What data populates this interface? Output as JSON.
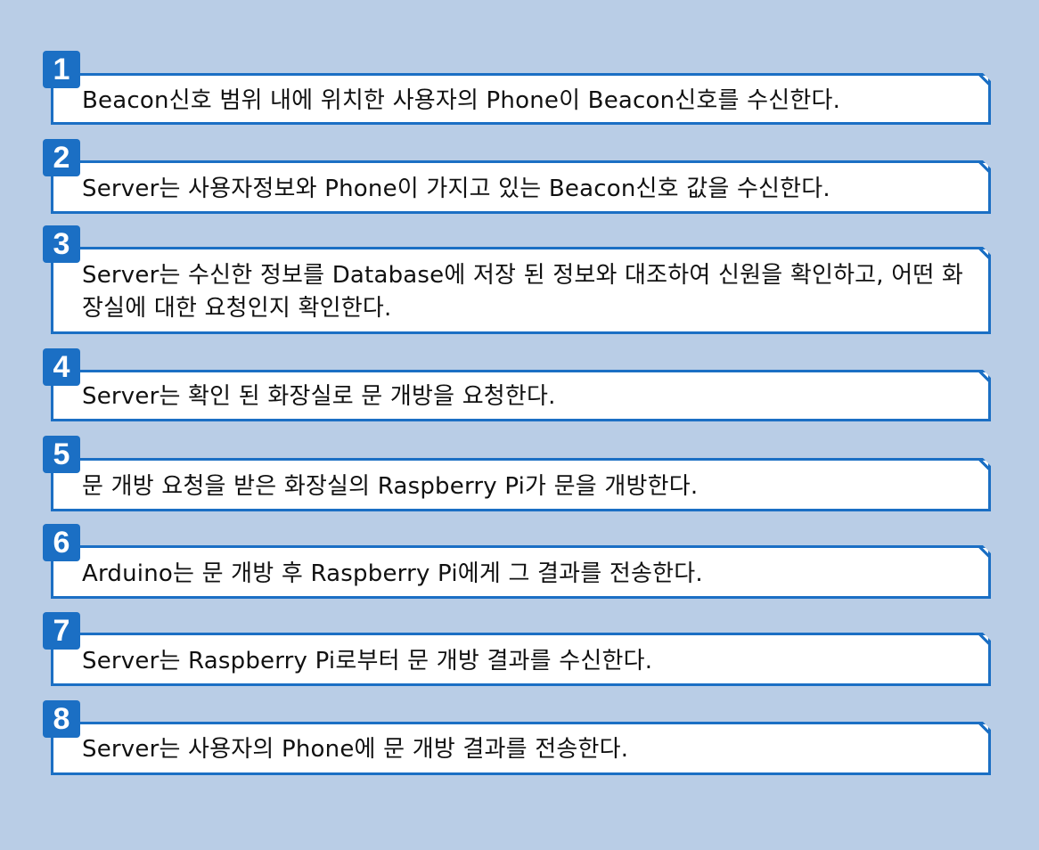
{
  "background_color": "#b9cde6",
  "accent_color": "#1b6fc4",
  "steps": [
    {
      "number": "1",
      "text": "Beacon신호 범위 내에 위치한 사용자의 Phone이 Beacon신호를 수신한다."
    },
    {
      "number": "2",
      "text": "Server는 사용자정보와 Phone이 가지고 있는 Beacon신호 값을 수신한다."
    },
    {
      "number": "3",
      "text": "Server는 수신한 정보를 Database에 저장 된 정보와 대조하여 신원을 확인하고, 어떤 화장실에 대한 요청인지 확인한다."
    },
    {
      "number": "4",
      "text": "Server는 확인 된 화장실로 문 개방을 요청한다."
    },
    {
      "number": "5",
      "text": "문 개방 요청을 받은 화장실의 Raspberry Pi가 문을 개방한다."
    },
    {
      "number": "6",
      "text": "Arduino는 문 개방 후 Raspberry Pi에게 그 결과를 전송한다."
    },
    {
      "number": "7",
      "text": "Server는 Raspberry Pi로부터 문 개방 결과를 수신한다."
    },
    {
      "number": "8",
      "text": "Server는 사용자의 Phone에 문 개방 결과를 전송한다."
    }
  ]
}
